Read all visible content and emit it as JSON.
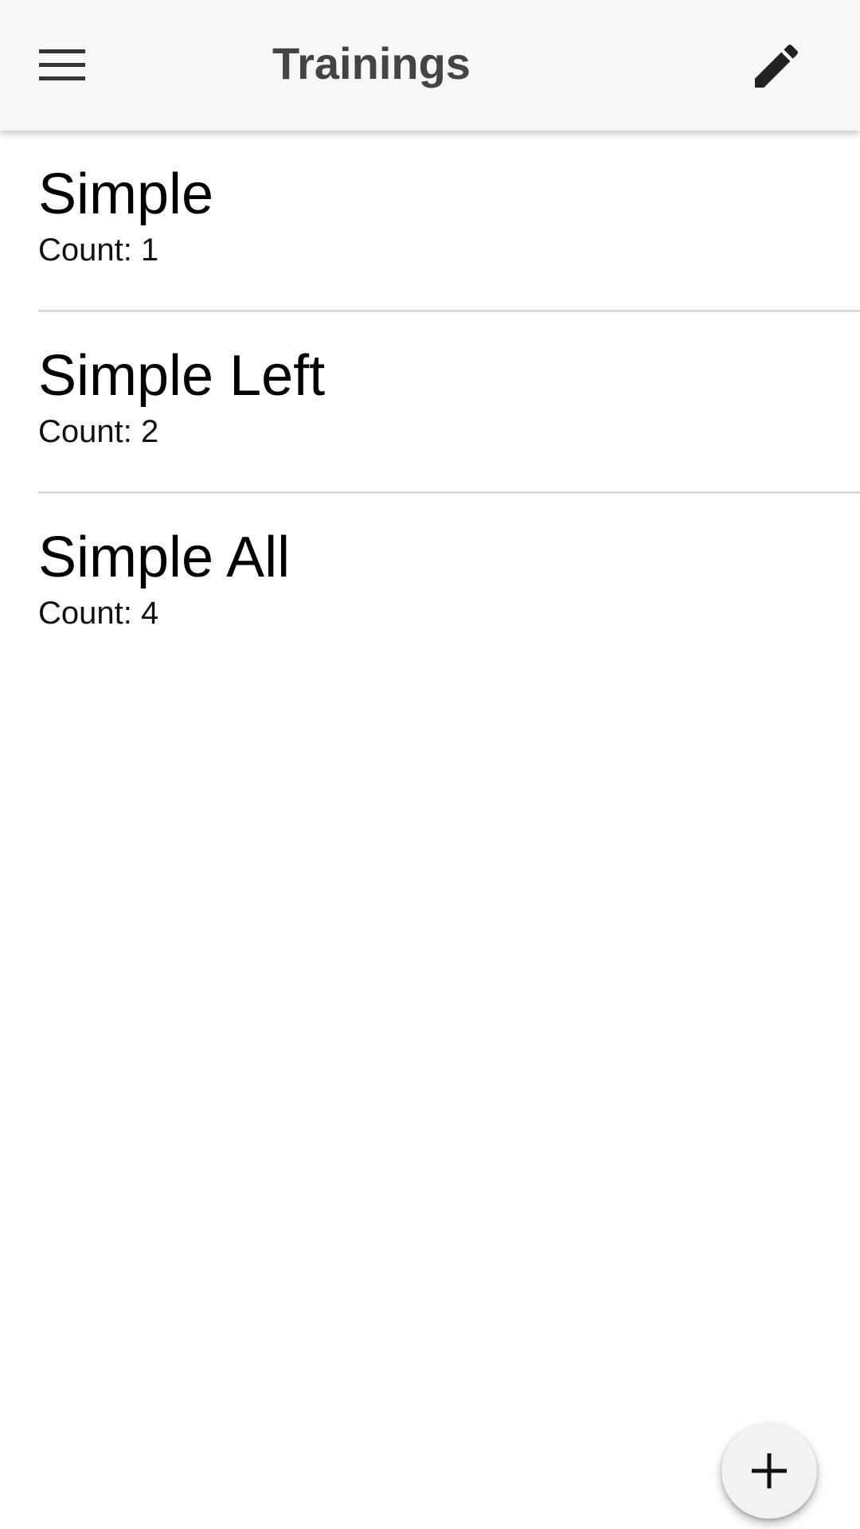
{
  "toolbar": {
    "title": "Trainings",
    "menu_icon": "menu-icon",
    "edit_icon": "pencil-icon"
  },
  "trainings": [
    {
      "name": "Simple",
      "count_label": "Count: 1"
    },
    {
      "name": "Simple Left",
      "count_label": "Count: 2"
    },
    {
      "name": "Simple All",
      "count_label": "Count: 4"
    }
  ],
  "fab": {
    "icon": "plus-icon"
  },
  "colors": {
    "toolbar_bg": "#f7f7f7",
    "title_text": "#444444",
    "divider": "#dcdcdc",
    "fab_bg": "#f2f2f2"
  }
}
